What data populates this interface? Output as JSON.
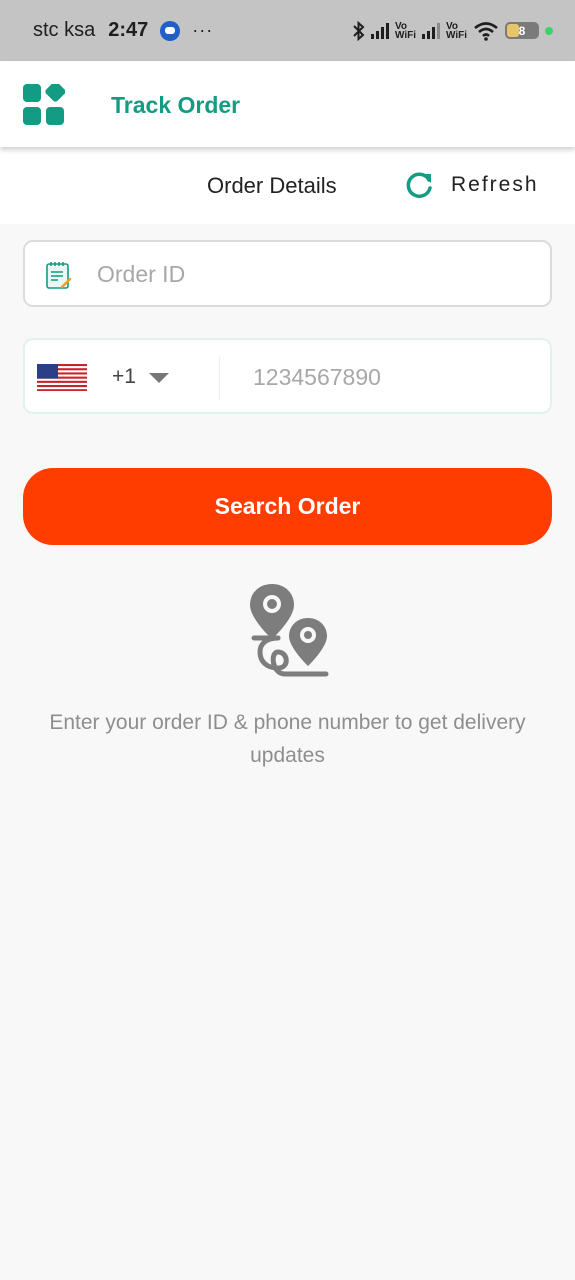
{
  "status_bar": {
    "carrier": "stc ksa",
    "time": "2:47",
    "more": "···",
    "vowifi_label_1": "Vo\nWiFi",
    "vowifi_label_2": "Vo\nWiFi",
    "battery": "8",
    "icons": [
      "message-icon",
      "bluetooth-icon",
      "signal-icon",
      "wifi-icon",
      "battery-icon"
    ]
  },
  "app_bar": {
    "title": "Track Order",
    "menu_icon": "apps-grid-icon"
  },
  "details": {
    "title": "Order Details",
    "refresh_label": "Refresh"
  },
  "form": {
    "order_id_placeholder": "Order ID",
    "order_id_value": "",
    "country_code": "+1",
    "country_flag": "us-flag",
    "phone_placeholder": "1234567890",
    "phone_value": "",
    "search_label": "Search Order"
  },
  "empty_state": {
    "icon": "route-location-icon",
    "message": "Enter your order ID & phone number to get delivery updates"
  },
  "colors": {
    "brand": "#139b83",
    "accent": "#ff3d00",
    "status_bar": "#c4c4c4"
  }
}
